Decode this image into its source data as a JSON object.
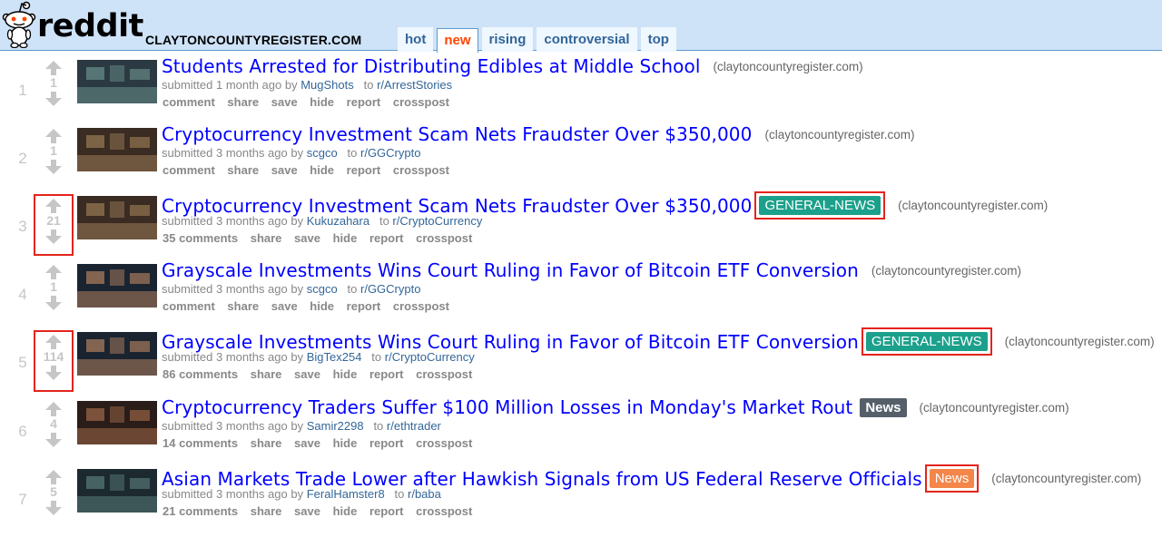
{
  "header": {
    "wordmark": "reddit",
    "domain": "CLAYTONCOUNTYREGISTER.COM",
    "tabs": [
      {
        "label": "hot",
        "selected": false
      },
      {
        "label": "new",
        "selected": true
      },
      {
        "label": "rising",
        "selected": false
      },
      {
        "label": "controversial",
        "selected": false
      },
      {
        "label": "top",
        "selected": false
      }
    ]
  },
  "posts": [
    {
      "rank": "1",
      "score": "1",
      "title": "Students Arrested for Distributing Edibles at Middle School",
      "flair": "",
      "flair_style": "",
      "domain": "(claytoncountyregister.com)",
      "submitted": "submitted 1 month ago by",
      "user": "MugShots",
      "to": "to",
      "subreddit": "r/ArrestStories",
      "comments": "comment",
      "highlight_vote": false
    },
    {
      "rank": "2",
      "score": "1",
      "title": "Cryptocurrency Investment Scam Nets Fraudster Over $350,000",
      "flair": "",
      "flair_style": "",
      "domain": "(claytoncountyregister.com)",
      "submitted": "submitted 3 months ago by",
      "user": "scgco",
      "to": "to",
      "subreddit": "r/GGCrypto",
      "comments": "comment",
      "highlight_vote": false
    },
    {
      "rank": "3",
      "score": "21",
      "title": "Cryptocurrency Investment Scam Nets Fraudster Over $350,000",
      "flair": "GENERAL-NEWS",
      "flair_style": "green",
      "domain": "(claytoncountyregister.com)",
      "submitted": "submitted 3 months ago by",
      "user": "Kukuzahara",
      "to": "to",
      "subreddit": "r/CryptoCurrency",
      "comments": "35 comments",
      "highlight_vote": true
    },
    {
      "rank": "4",
      "score": "1",
      "title": "Grayscale Investments Wins Court Ruling in Favor of Bitcoin ETF Conversion",
      "flair": "",
      "flair_style": "",
      "domain": "(claytoncountyregister.com)",
      "submitted": "submitted 3 months ago by",
      "user": "scgco",
      "to": "to",
      "subreddit": "r/GGCrypto",
      "comments": "comment",
      "highlight_vote": false
    },
    {
      "rank": "5",
      "score": "114",
      "title": "Grayscale Investments Wins Court Ruling in Favor of Bitcoin ETF Conversion",
      "flair": "GENERAL-NEWS",
      "flair_style": "green",
      "domain": "(claytoncountyregister.com)",
      "submitted": "submitted 3 months ago by",
      "user": "BigTex254",
      "to": "to",
      "subreddit": "r/CryptoCurrency",
      "comments": "86 comments",
      "highlight_vote": true
    },
    {
      "rank": "6",
      "score": "4",
      "title": "Cryptocurrency Traders Suffer $100 Million Losses in Monday's Market Rout",
      "flair": "News",
      "flair_style": "gray",
      "domain": "(claytoncountyregister.com)",
      "submitted": "submitted 3 months ago by",
      "user": "Samir2298",
      "to": "to",
      "subreddit": "r/ethtrader",
      "comments": "14 comments",
      "highlight_vote": false
    },
    {
      "rank": "7",
      "score": "5",
      "title": "Asian Markets Trade Lower after Hawkish Signals from US Federal Reserve Officials",
      "flair": "News",
      "flair_style": "orange",
      "domain": "(claytoncountyregister.com)",
      "submitted": "submitted 3 months ago by",
      "user": "FeralHamster8",
      "to": "to",
      "subreddit": "r/baba",
      "comments": "21 comments",
      "highlight_vote": false
    }
  ],
  "action_labels": {
    "share": "share",
    "save": "save",
    "hide": "hide",
    "report": "report",
    "crosspost": "crosspost"
  },
  "colors": {
    "header_bg": "#cee3f8",
    "link": "#0000ff",
    "accent": "#ff4500",
    "flair_green": "#1ba08b",
    "highlight": "#e3241c"
  }
}
